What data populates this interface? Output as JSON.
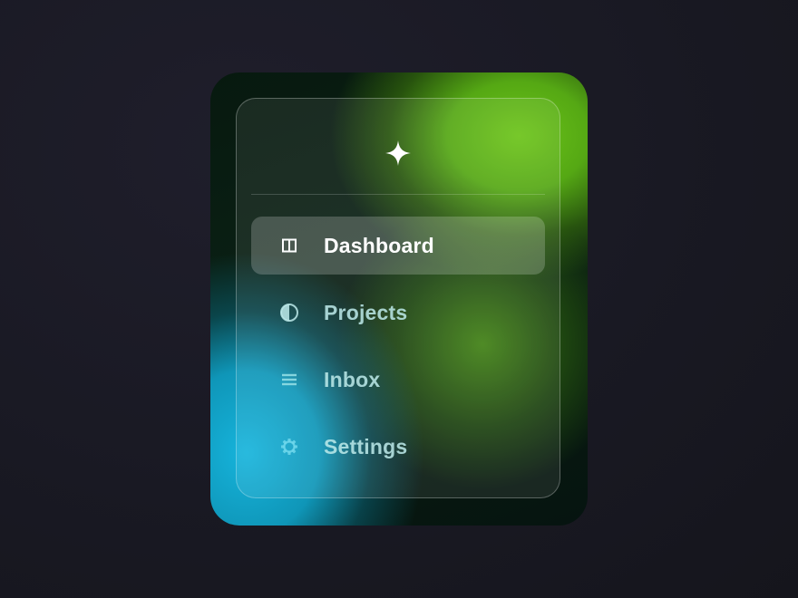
{
  "sidebar": {
    "logo_icon": "sparkle-icon",
    "items": [
      {
        "label": "Dashboard",
        "icon": "columns-icon",
        "active": true
      },
      {
        "label": "Projects",
        "icon": "half-circle-icon",
        "active": false
      },
      {
        "label": "Inbox",
        "icon": "menu-lines-icon",
        "active": false
      },
      {
        "label": "Settings",
        "icon": "gear-icon",
        "active": false
      }
    ]
  },
  "colors": {
    "accent_green": "#6cc418",
    "accent_cyan": "#16b4dc",
    "background": "#191923",
    "label_inactive": "#bee9e9",
    "label_active": "#ffffff"
  }
}
